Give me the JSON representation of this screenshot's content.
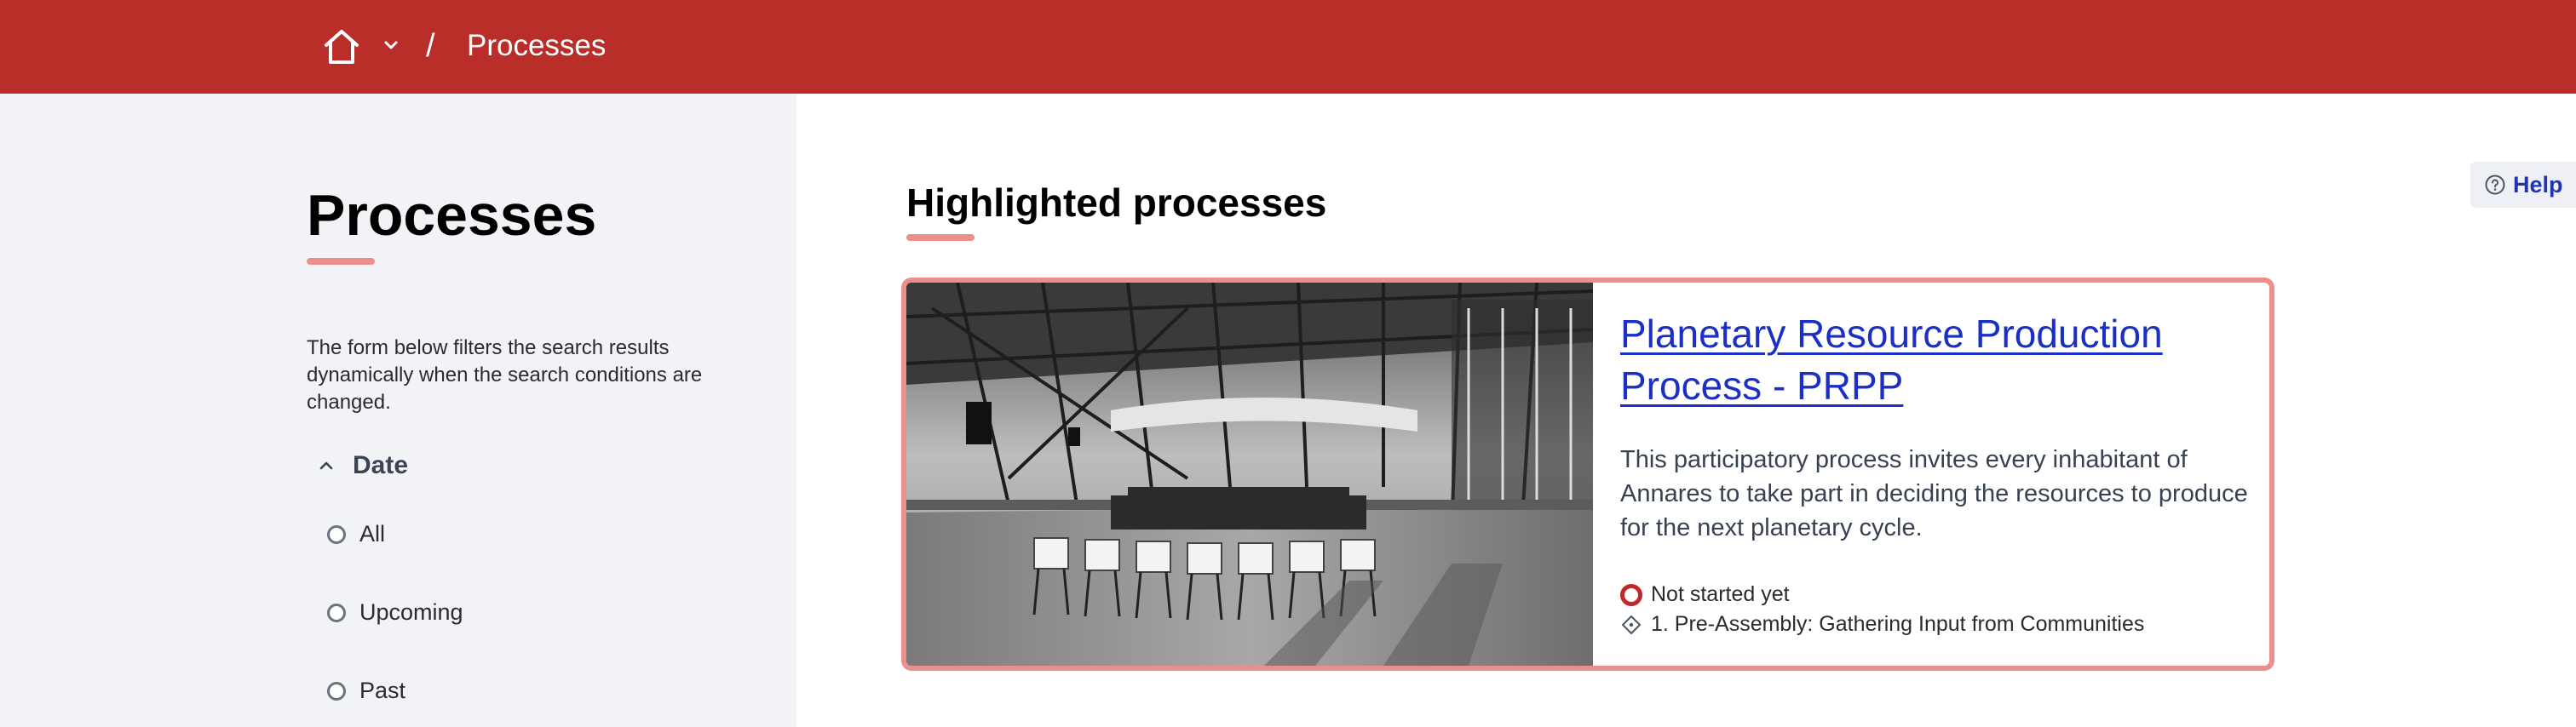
{
  "header": {
    "breadcrumb_separator": "/",
    "breadcrumb_current": "Processes",
    "home_icon": "home-icon",
    "dropdown_icon": "chevron-down-icon",
    "bar_color": "#ba2e29"
  },
  "sidebar": {
    "title": "Processes",
    "description": "The form below filters the search results dynamically when the search conditions are changed.",
    "filter": {
      "label": "Date",
      "toggle_icon": "chevron-up-icon",
      "options": [
        {
          "label": "All",
          "selected": false
        },
        {
          "label": "Upcoming",
          "selected": false
        },
        {
          "label": "Past",
          "selected": false
        }
      ]
    }
  },
  "main": {
    "section_title": "Highlighted processes",
    "help_label": "Help",
    "accent_color": "#ec8f8c",
    "card": {
      "title": "Planetary Resource Production Process - PRPP",
      "description": "This participatory process invites every inhabitant of Annares to take part in deciding the resources to produce for the next planetary cycle.",
      "status": "Not started yet",
      "step": "1. Pre-Assembly: Gathering Input from Communities",
      "status_color": "#c0282b",
      "link_color": "#1b2fc4"
    }
  }
}
